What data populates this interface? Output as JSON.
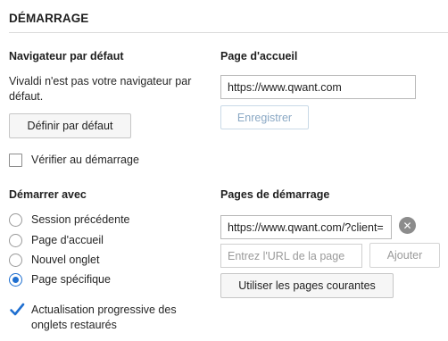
{
  "section": {
    "title": "DÉMARRAGE"
  },
  "default_browser": {
    "heading": "Navigateur par défaut",
    "status_line1": "Vivaldi n'est pas votre navigateur par",
    "status_line2": "défaut.",
    "set_default_label": "Définir par défaut",
    "check_on_startup_label": "Vérifier au démarrage",
    "check_on_startup_checked": false
  },
  "homepage": {
    "heading": "Page d'accueil",
    "url_value": "https://www.qwant.com",
    "save_label": "Enregistrer"
  },
  "start_with": {
    "heading": "Démarrer avec",
    "options": [
      {
        "label": "Session précédente",
        "selected": false
      },
      {
        "label": "Page d'accueil",
        "selected": false
      },
      {
        "label": "Nouvel onglet",
        "selected": false
      },
      {
        "label": "Page spécifique",
        "selected": true
      }
    ],
    "progressive_line1": "Actualisation progressive des",
    "progressive_line2": "onglets restaurés",
    "progressive_checked": true
  },
  "startup_pages": {
    "heading": "Pages de démarrage",
    "page_url": "https://www.qwant.com/?client=",
    "clear_icon": "close-icon",
    "new_url_placeholder": "Entrez l'URL de la page",
    "add_label": "Ajouter",
    "use_current_label": "Utiliser les pages courantes"
  },
  "colors": {
    "accent": "#1f6fd0",
    "disabled_text": "#8aa8c4"
  }
}
